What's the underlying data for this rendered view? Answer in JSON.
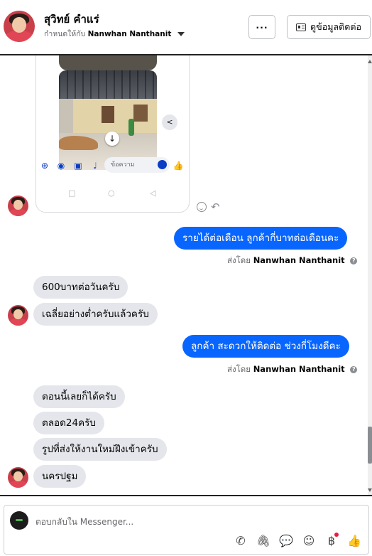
{
  "header": {
    "contact_name": "สุวิทย์ คำแร่",
    "assigned_prefix": "กำหนดให้กับ",
    "assigned_to": "Nanwhan Nanthanit",
    "more_label": "···",
    "view_contact_label": "ดูข้อมูลติดต่อ"
  },
  "phone_screenshot": {
    "input_placeholder": "ข้อความ"
  },
  "messages": [
    {
      "dir": "out",
      "text": "รายได้ต่อเดือน ลูกค้ากี่บาทต่อเดือนคะ"
    },
    {
      "dir": "in",
      "text": "600บาทต่อวันครับ"
    },
    {
      "dir": "in",
      "text": "เฉลี่ยอย่างต่ำครับแล้วครับ"
    },
    {
      "dir": "out",
      "text": "ลูกค้า สะดวกให้ติดต่อ ช่วงกี่โมงดีคะ"
    },
    {
      "dir": "in",
      "text": "ตอนนี้เลยก็ได้ครับ"
    },
    {
      "dir": "in",
      "text": "ตลอด24ครับ"
    },
    {
      "dir": "in",
      "text": "รูปที่ส่งให้งานใหม่ฝึงเข้าครับ"
    },
    {
      "dir": "in",
      "text": "นครปฐม"
    }
  ],
  "sent_by": {
    "prefix": "ส่งโดย",
    "name": "Nanwhan Nanthanit"
  },
  "composer": {
    "placeholder": "ตอบกลับใน Messenger..."
  },
  "colors": {
    "outgoing_bubble": "#0866ff",
    "incoming_bubble": "#e4e6eb",
    "phone_accent": "#0a3cc4"
  }
}
